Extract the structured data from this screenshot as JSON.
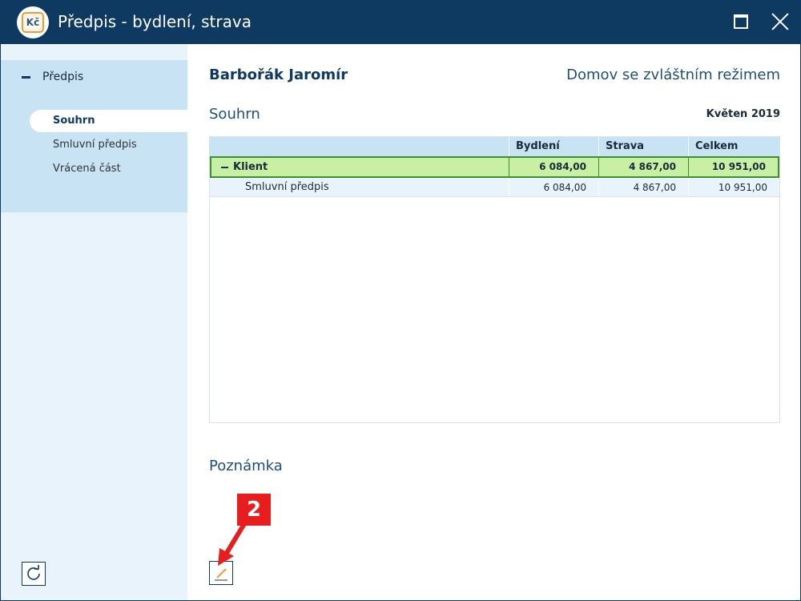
{
  "window": {
    "title": "Předpis - bydlení, strava",
    "app_icon_text": "Kč"
  },
  "sidebar": {
    "group_label": "Předpis",
    "items": [
      {
        "label": "Souhrn",
        "active": true
      },
      {
        "label": "Smluvní předpis",
        "active": false
      },
      {
        "label": "Vrácená část",
        "active": false
      }
    ]
  },
  "header": {
    "client_name": "Barbořák Jaromír",
    "facility": "Domov se zvláštním režimem"
  },
  "summary": {
    "title": "Souhrn",
    "period": "Květen 2019",
    "columns": [
      "Bydlení",
      "Strava",
      "Celkem"
    ],
    "group_row": {
      "label": "Klient",
      "values": [
        "6 084,00",
        "4 867,00",
        "10 951,00"
      ]
    },
    "rows": [
      {
        "label": "Smluvní předpis",
        "values": [
          "6 084,00",
          "4 867,00",
          "10 951,00"
        ]
      }
    ]
  },
  "note": {
    "title": "Poznámka"
  },
  "callout": {
    "number": "2",
    "color": "#e81e1e"
  }
}
